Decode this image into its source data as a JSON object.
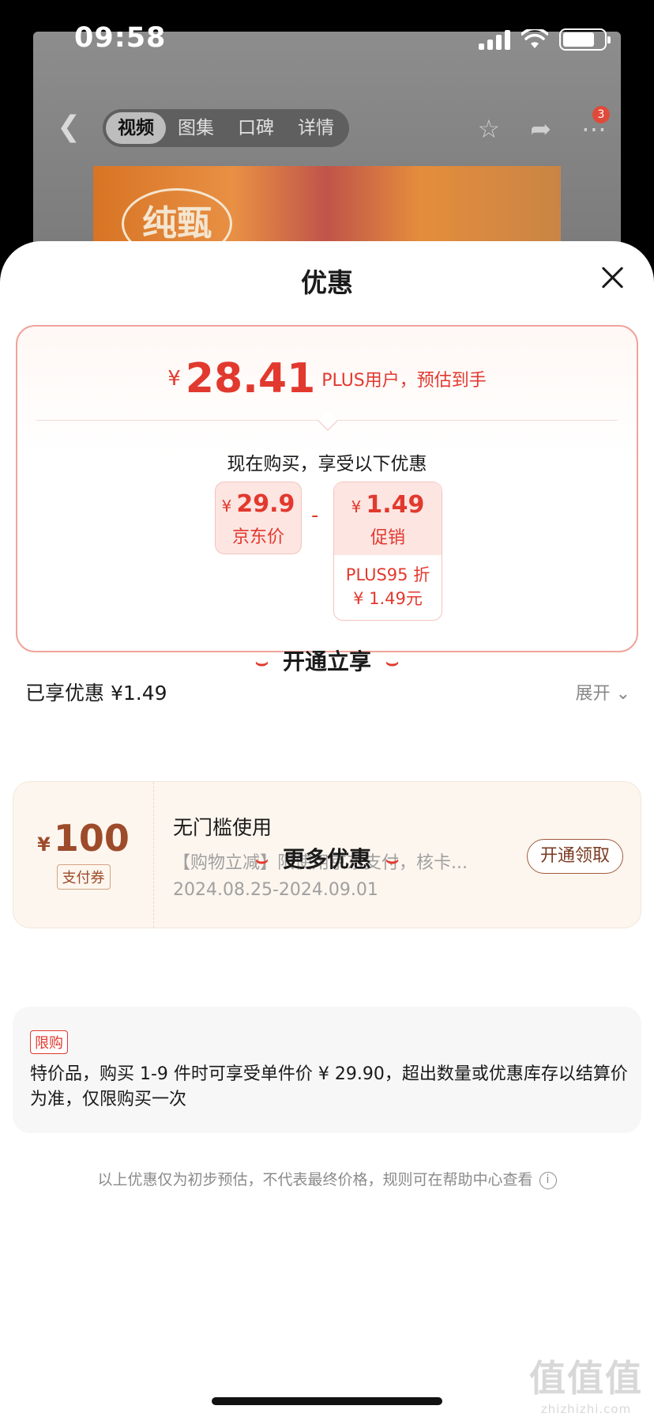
{
  "status_bar": {
    "time": "09:58"
  },
  "nav": {
    "tabs": [
      "视频",
      "图集",
      "口碑",
      "详情"
    ],
    "badge": "3"
  },
  "product": {
    "logo_text": "纯甄"
  },
  "sheet": {
    "title": "优惠",
    "estimate": {
      "currency": "¥",
      "price": "28.41",
      "label": "PLUS用户，预估到手"
    },
    "buy_now_text": "现在购买，享受以下优惠",
    "jd_price": {
      "currency": "¥",
      "amount": "29.9",
      "label": "京东价"
    },
    "minus": "-",
    "promo": {
      "currency": "¥",
      "amount": "1.49",
      "label": "促销",
      "sub1": "PLUS95 折",
      "sub2": "¥ 1.49元"
    },
    "enjoyed": "已享优惠 ¥1.49",
    "expand": "展开",
    "open_section_title": "开通立享",
    "coupon": {
      "currency": "¥",
      "amount": "100",
      "tag": "支付券",
      "title": "无门槛使用",
      "desc": "【购物立减】限使用京东支付，核卡...",
      "date": "2024.08.25-2024.09.01",
      "button": "开通领取"
    },
    "more_section_title": "更多优惠",
    "more": {
      "tag": "限购",
      "text": "特价品，购买 1-9 件时可享受单件价 ¥ 29.90，超出数量或优惠库存以结算价为准，仅限购买一次"
    },
    "footnote": "以上优惠仅为初步预估，不代表最终价格，规则可在帮助中心查看"
  },
  "watermark": {
    "line1": "值值值",
    "line2": "zhizhizhi.com"
  },
  "colors": {
    "accent": "#e2392e",
    "coupon_brown": "#9d4b2a",
    "sheet_bg": "#ffffff"
  }
}
